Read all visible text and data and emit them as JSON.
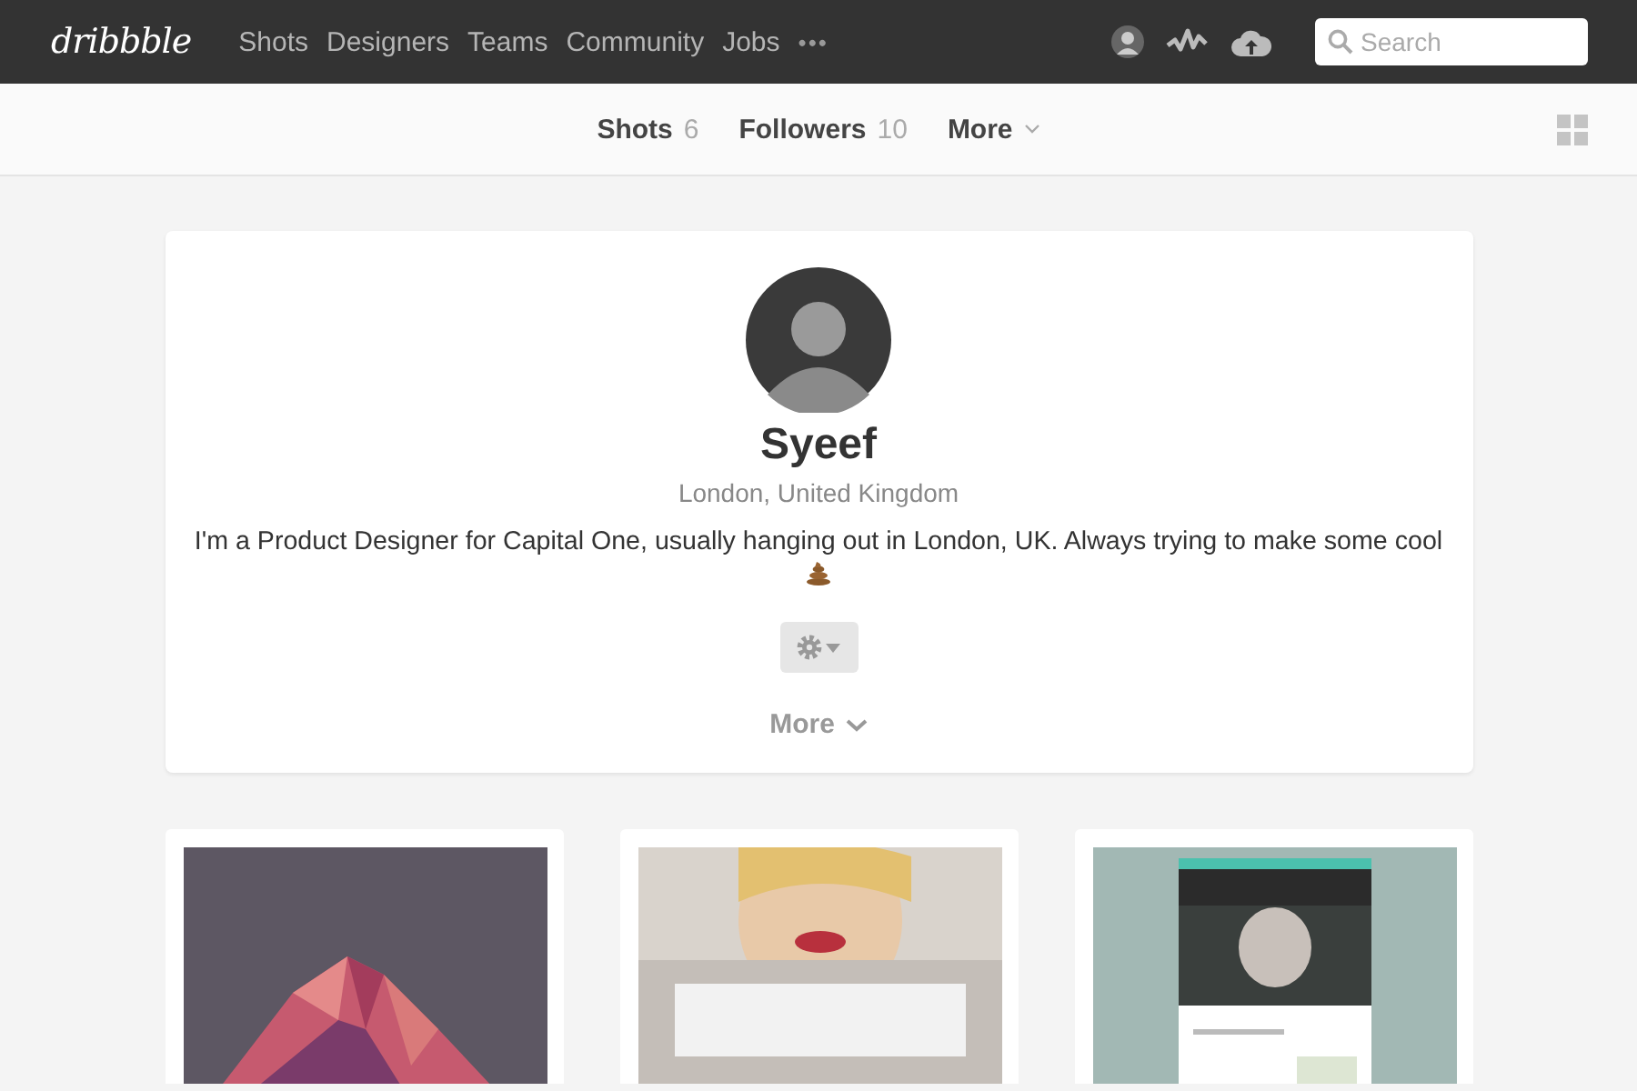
{
  "header": {
    "logo": "dribbble",
    "nav": [
      {
        "label": "Shots"
      },
      {
        "label": "Designers"
      },
      {
        "label": "Teams"
      },
      {
        "label": "Community"
      },
      {
        "label": "Jobs"
      }
    ],
    "more": "•••",
    "search": {
      "placeholder": "Search"
    }
  },
  "subnav": {
    "tabs": [
      {
        "label": "Shots",
        "count": "6"
      },
      {
        "label": "Followers",
        "count": "10"
      }
    ],
    "more": "More"
  },
  "profile": {
    "name": "Syeef",
    "location": "London, United Kingdom",
    "bio": "I'm a Product Designer for Capital One, usually hanging out in London, UK. Always trying to make some cool",
    "more": "More"
  }
}
